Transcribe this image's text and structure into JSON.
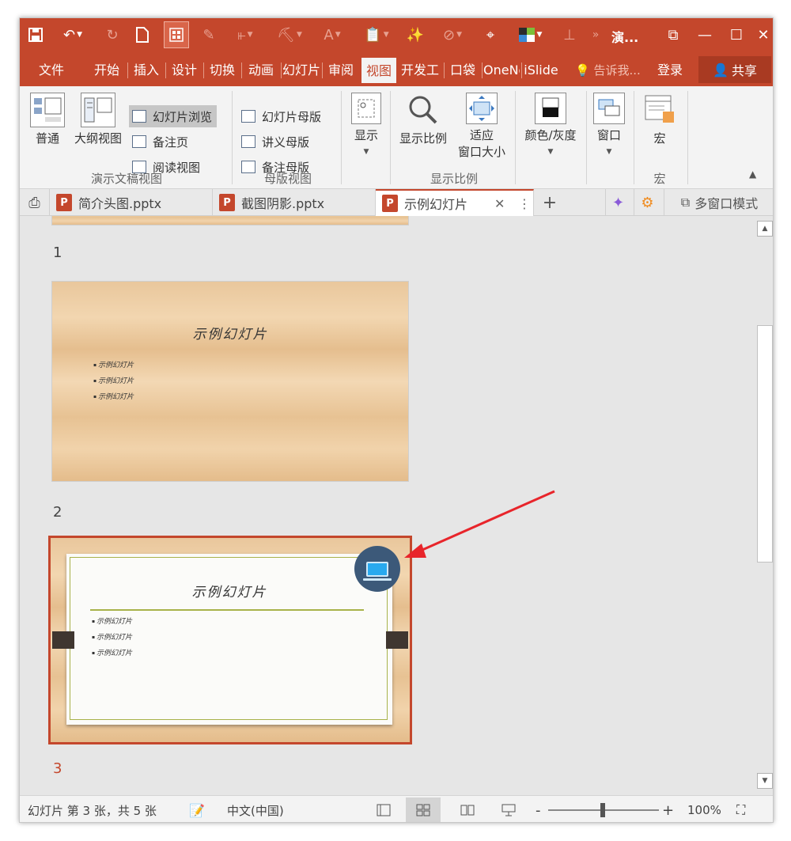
{
  "title_bar": {
    "doc_title": "演...",
    "quick_access": [
      "save-icon",
      "undo-icon",
      "redo-icon",
      "new-file-icon",
      "slide-sorter-icon",
      "pen-icon",
      "align-icon",
      "format-painter-icon",
      "font-icon",
      "paste-icon",
      "magic-icon",
      "shape-icon",
      "focus-icon",
      "color-icon",
      "distribute-icon"
    ],
    "more": "»",
    "window_buttons": {
      "restore": "⧉",
      "minimize": "—",
      "maximize": "☐",
      "close": "✕"
    }
  },
  "ribbon_tabs": [
    {
      "label": "文件"
    },
    {
      "label": "开始"
    },
    {
      "label": "插入"
    },
    {
      "label": "设计"
    },
    {
      "label": "切换"
    },
    {
      "label": "动画"
    },
    {
      "label": "幻灯片"
    },
    {
      "label": "审阅"
    },
    {
      "label": "视图"
    },
    {
      "label": "开发工"
    },
    {
      "label": "口袋"
    },
    {
      "label": "OneNote"
    },
    {
      "label": "iSlide"
    }
  ],
  "active_tab": "视图",
  "tell_me": "告诉我...",
  "login": "登录",
  "share": "共享",
  "ribbon": {
    "presentation_views": {
      "label": "演示文稿视图",
      "normal": "普通",
      "outline": "大纲视图",
      "slide_sorter": "幻灯片浏览",
      "notes_page": "备注页",
      "reading_view": "阅读视图"
    },
    "master_views": {
      "label": "母版视图",
      "slide_master": "幻灯片母版",
      "handout_master": "讲义母版",
      "notes_master": "备注母版"
    },
    "show": {
      "label": "显示"
    },
    "zoom": {
      "label": "显示比例",
      "zoom": "显示比例",
      "fit_line1": "适应",
      "fit_line2": "窗口大小"
    },
    "color": {
      "label": "颜色/灰度"
    },
    "window": {
      "label": "窗口"
    },
    "macros": {
      "label": "宏",
      "group": "宏"
    }
  },
  "doc_tabs": [
    {
      "name": "简介头图.pptx",
      "active": false
    },
    {
      "name": "截图阴影.pptx",
      "active": false
    },
    {
      "name": "示例幻灯片",
      "active": true
    }
  ],
  "doc_tab_buttons": {
    "close": "✕",
    "more": "⋮",
    "add": "+",
    "multi_window": "多窗口模式"
  },
  "slides": [
    {
      "number": "1",
      "selected": false
    },
    {
      "number": "2",
      "selected": false,
      "title": "示例幻灯片",
      "bullets": [
        "示例幻灯片",
        "示例幻灯片",
        "示例幻灯片"
      ]
    },
    {
      "number": "3",
      "selected": true,
      "title": "示例幻灯片",
      "bullets": [
        "示例幻灯片",
        "示例幻灯片",
        "示例幻灯片"
      ]
    }
  ],
  "status_bar": {
    "slide_info": "幻灯片 第 3 张，共 5 张",
    "language": "中文(中国)",
    "zoom": "100%",
    "minus": "-",
    "plus": "+"
  },
  "colors": {
    "accent": "#c4472c",
    "annotation_arrow": "#e8252b",
    "badge": "#3c5979"
  }
}
